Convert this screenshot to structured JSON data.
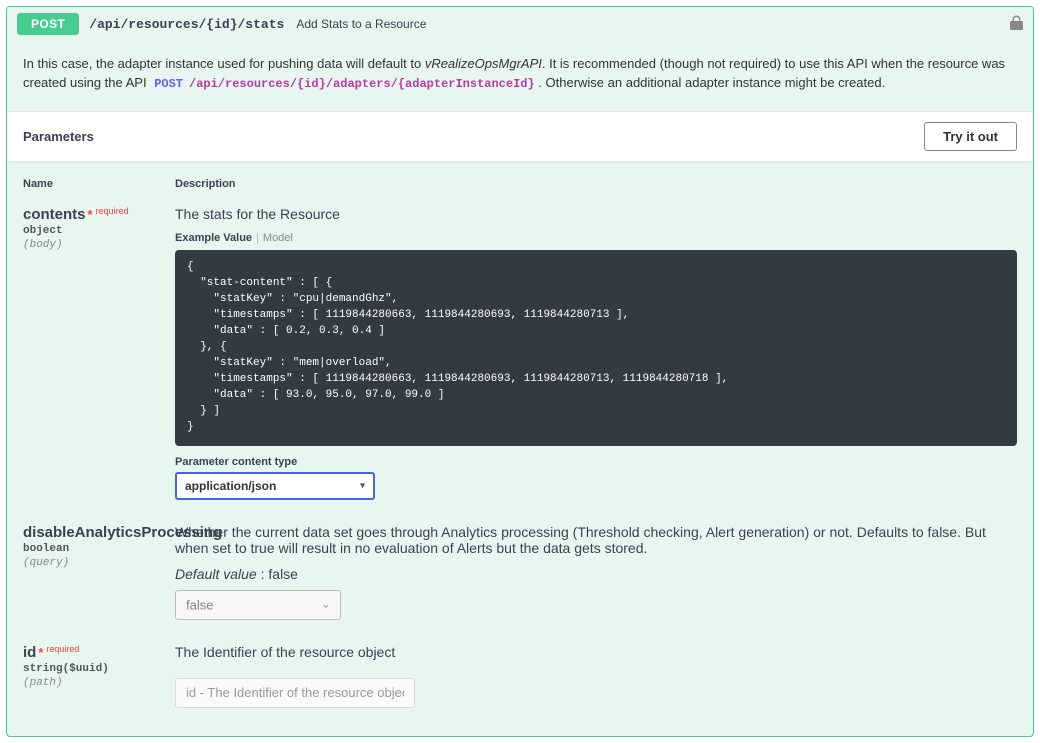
{
  "operation": {
    "method": "POST",
    "path": "/api/resources/{id}/stats",
    "summary": "Add Stats to a Resource"
  },
  "description": {
    "prefix": "In this case, the adapter instance used for pushing data will default to ",
    "defaultAdapter": "vRealizeOpsMgrAPI",
    "afterAdapter": ". It is recommended (though not required) to use this API when the resource was created using the API ",
    "refMethod": "POST",
    "refPath": "/api/resources/{id}/adapters/{adapterInstanceId}",
    "suffix": " . Otherwise an additional adapter instance might be created."
  },
  "paramsTitle": "Parameters",
  "tryItOut": "Try it out",
  "headers": {
    "name": "Name",
    "description": "Description"
  },
  "params": {
    "contents": {
      "name": "contents",
      "required": true,
      "requiredLabel": "required",
      "type": "object",
      "in": "(body)",
      "desc": "The stats for the Resource",
      "exampleValueLabel": "Example Value",
      "modelLabel": "Model",
      "code": "{\n  \"stat-content\" : [ {\n    \"statKey\" : \"cpu|demandGhz\",\n    \"timestamps\" : [ 1119844280663, 1119844280693, 1119844280713 ],\n    \"data\" : [ 0.2, 0.3, 0.4 ]\n  }, {\n    \"statKey\" : \"mem|overload\",\n    \"timestamps\" : [ 1119844280663, 1119844280693, 1119844280713, 1119844280718 ],\n    \"data\" : [ 93.0, 95.0, 97.0, 99.0 ]\n  } ]\n}",
      "pctLabel": "Parameter content type",
      "contentType": "application/json"
    },
    "dap": {
      "name": "disableAnalyticsProcessing",
      "required": false,
      "type": "boolean",
      "in": "(query)",
      "desc": "Whether the current data set goes through Analytics processing (Threshold checking, Alert generation) or not. Defaults to false. But when set to true will result in no evaluation of Alerts but the data gets stored.",
      "defaultLabel": "Default value",
      "defaultValue": "false",
      "selectValue": "false"
    },
    "id": {
      "name": "id",
      "required": true,
      "requiredLabel": "required",
      "type": "string($uuid)",
      "in": "(path)",
      "desc": "The Identifier of the resource object",
      "placeholder": "id - The Identifier of the resource object"
    }
  }
}
